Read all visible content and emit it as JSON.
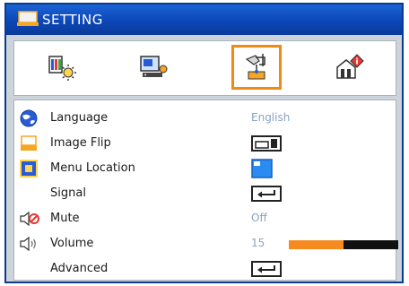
{
  "window": {
    "title": "SETTING"
  },
  "tabs": [
    {
      "name": "image",
      "active": false
    },
    {
      "name": "display",
      "active": false
    },
    {
      "name": "setting",
      "active": true
    },
    {
      "name": "options",
      "active": false
    }
  ],
  "accent_color": "#f08a12",
  "menu": {
    "language": {
      "label": "Language",
      "value": "English"
    },
    "image_flip": {
      "label": "Image Flip"
    },
    "menu_location": {
      "label": "Menu Location"
    },
    "signal": {
      "label": "Signal"
    },
    "mute": {
      "label": "Mute",
      "value": "Off"
    },
    "volume": {
      "label": "Volume",
      "value": "15",
      "level_percent": 50
    },
    "advanced": {
      "label": "Advanced"
    }
  }
}
